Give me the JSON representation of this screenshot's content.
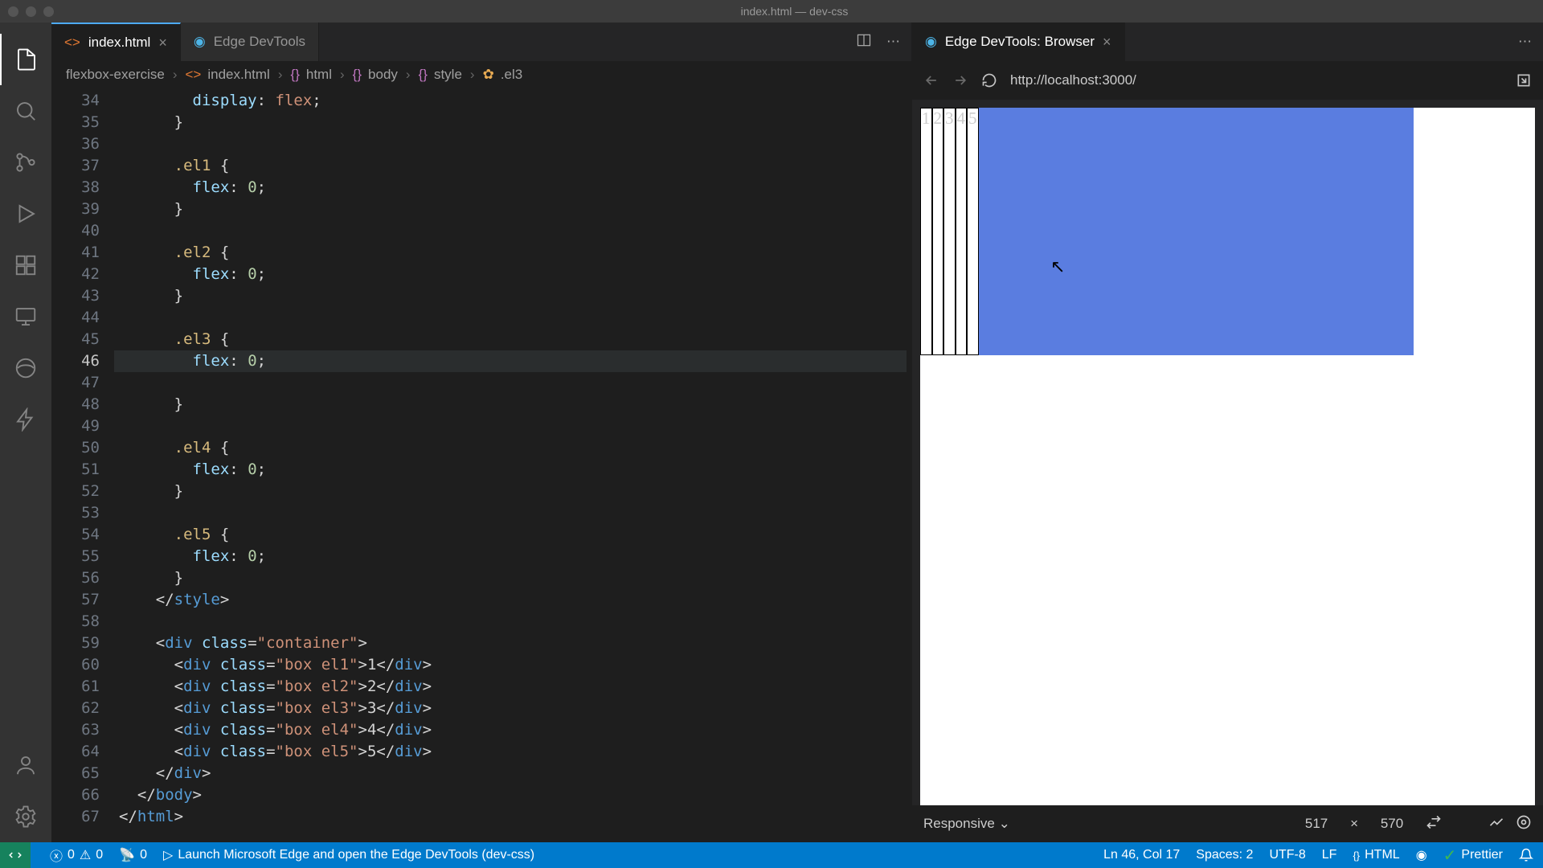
{
  "window": {
    "title": "index.html — dev-css"
  },
  "tabs": {
    "file": "index.html",
    "devtools": "Edge DevTools",
    "browser_tab": "Edge DevTools: Browser"
  },
  "breadcrumbs": {
    "folder": "flexbox-exercise",
    "file": "index.html",
    "path": [
      "html",
      "body",
      "style",
      ".el3"
    ]
  },
  "gutter": {
    "lines": [
      "34",
      "35",
      "36",
      "37",
      "38",
      "39",
      "40",
      "41",
      "42",
      "43",
      "44",
      "45",
      "46",
      "47",
      "48",
      "49",
      "50",
      "51",
      "52",
      "53",
      "54",
      "55",
      "56",
      "57",
      "58",
      "59",
      "60",
      "61",
      "62",
      "63",
      "64",
      "65",
      "66",
      "67"
    ],
    "current": "46"
  },
  "code": {
    "l34_prop": "display",
    "l34_val": "flex",
    "el1": ".el1",
    "el2": ".el2",
    "el3": ".el3",
    "el4": ".el4",
    "el5": ".el5",
    "flex_prop": "flex",
    "flex_val": "0",
    "style_close": "style",
    "div": "div",
    "class_attr": "class",
    "container_cls": "\"container\"",
    "box1": "\"box el1\"",
    "box2": "\"box el2\"",
    "box3": "\"box el3\"",
    "box4": "\"box el4\"",
    "box5": "\"box el5\"",
    "n1": "1",
    "n2": "2",
    "n3": "3",
    "n4": "4",
    "n5": "5",
    "body_close": "body",
    "html_close": "html"
  },
  "browser": {
    "url": "http://localhost:3000/"
  },
  "preview": {
    "boxes": [
      "1",
      "2",
      "3",
      "4",
      "5"
    ],
    "mode": "Responsive",
    "width": "517",
    "height": "570",
    "times": "×"
  },
  "status": {
    "errors": "0",
    "warnings": "0",
    "ports": "0",
    "launch": "Launch Microsoft Edge and open the Edge DevTools (dev-css)",
    "cursor": "Ln 46, Col 17",
    "spaces": "Spaces: 2",
    "encoding": "UTF-8",
    "eol": "LF",
    "lang": "HTML",
    "prettier": "Prettier"
  }
}
